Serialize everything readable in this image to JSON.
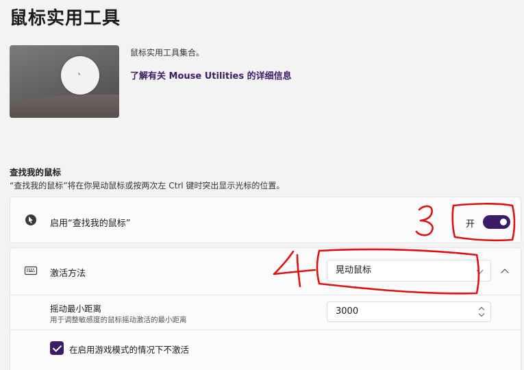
{
  "page": {
    "title": "鼠标实用工具"
  },
  "hero": {
    "description": "鼠标实用工具集合。",
    "learn_more": "了解有关 Mouse Utilities 的详细信息"
  },
  "find_my_mouse": {
    "section_title": "查找我的鼠标",
    "section_desc": "“查找我的鼠标”将在你晃动鼠标或按两次左 Ctrl 键时突出显示光标的位置。",
    "enable_label": "启用“查找我的鼠标”",
    "enable_state": "开",
    "enabled": true,
    "activation_label": "激活方法",
    "activation_value": "晃动鼠标",
    "min_distance_label": "摇动最小距离",
    "min_distance_desc": "用于调整敏感度的鼠标摇动激活的最小距离",
    "min_distance_value": "3000",
    "game_mode_label": "在启用游戏模式的情况下不激活",
    "game_mode_checked": true
  },
  "annotations": {
    "mark_3": "3",
    "mark_4": "4",
    "ink_color": "#e01010"
  },
  "colors": {
    "accent": "#3b1a66",
    "background": "#f3f3f3",
    "card": "#fbfbfb"
  }
}
